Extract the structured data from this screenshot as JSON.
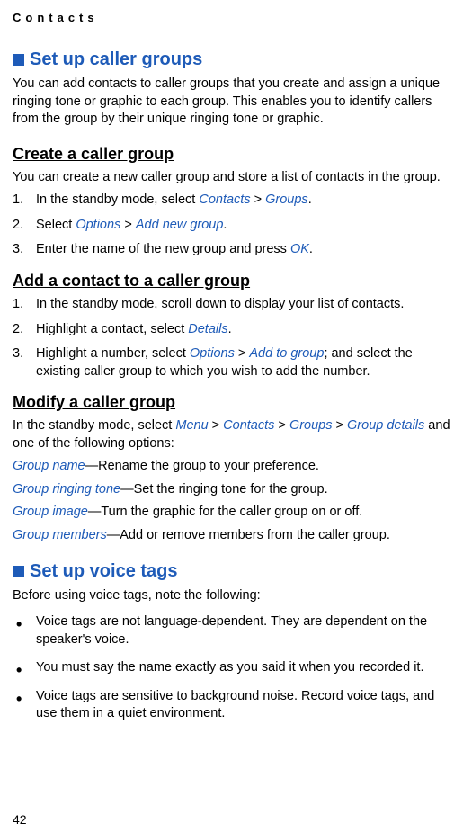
{
  "header": "Contacts",
  "section1": {
    "title": "Set up caller groups",
    "intro": "You can add contacts to caller groups that you create and assign a unique ringing tone or graphic to each group. This enables you to identify callers from the group by their unique ringing tone or graphic."
  },
  "subsection1": {
    "title": "Create a caller group",
    "intro": "You can create a new caller group and store a list of contacts in the group.",
    "step1_a": "In the standby mode, select ",
    "step1_link1": "Contacts",
    "step1_gt": " > ",
    "step1_link2": "Groups",
    "step1_end": ".",
    "step2_a": "Select ",
    "step2_link1": "Options",
    "step2_gt": " > ",
    "step2_link2": "Add new group",
    "step2_end": ".",
    "step3_a": "Enter the name of the new group and press ",
    "step3_link1": "OK",
    "step3_end": "."
  },
  "subsection2": {
    "title": "Add a contact to a caller group",
    "step1": "In the standby mode, scroll down to display your list of contacts.",
    "step2_a": "Highlight a contact, select ",
    "step2_link1": "Details",
    "step2_end": ".",
    "step3_a": "Highlight a number, select ",
    "step3_link1": "Options",
    "step3_gt": " > ",
    "step3_link2": "Add to group",
    "step3_end": "; and select the existing caller group to which you wish to add the number."
  },
  "subsection3": {
    "title": "Modify a caller group",
    "intro_a": "In the standby mode, select ",
    "intro_link1": "Menu",
    "intro_gt1": " > ",
    "intro_link2": "Contacts",
    "intro_gt2": " > ",
    "intro_link3": "Groups",
    "intro_gt3": " > ",
    "intro_link4": "Group details",
    "intro_end": " and one of the following options:",
    "opt1_label": "Group name",
    "opt1_desc": "—Rename the group to your preference.",
    "opt2_label": "Group ringing tone",
    "opt2_desc": "—Set the ringing tone for the group.",
    "opt3_label": "Group image",
    "opt3_desc": "—Turn the graphic for the caller group on or off.",
    "opt4_label": "Group members",
    "opt4_desc": "—Add or remove members from the caller group."
  },
  "section2": {
    "title": "Set up voice tags",
    "intro": "Before using voice tags, note the following:",
    "bullet1": "Voice tags are not language-dependent. They are dependent on the speaker's voice.",
    "bullet2": "You must say the name exactly as you said it when you recorded it.",
    "bullet3": "Voice tags are sensitive to background noise. Record voice tags, and use them in a quiet environment."
  },
  "page_number": "42"
}
